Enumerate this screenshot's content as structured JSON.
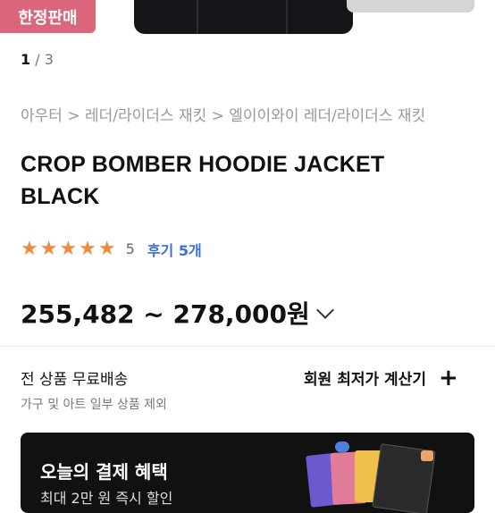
{
  "top": {
    "badge": "한정판매"
  },
  "pager": {
    "current": "1",
    "separator": " / ",
    "total": "3"
  },
  "breadcrumb": {
    "text": "아우터 > 레더/라이더스 재킷 > 엘이이와이 레더/라이더스 재킷"
  },
  "product": {
    "title": "CROP BOMBER HOODIE JACKET BLACK",
    "stars": "★★★★★",
    "rating": "5",
    "review_link": "후기 5개",
    "price": "255,482 ~ 278,000원"
  },
  "shipping": {
    "main": "전 상품 무료배송",
    "sub": "가구 및 아트 일부 상품 제외",
    "calc_label": "회원 최저가 계산기",
    "calc_icon": "+"
  },
  "banner": {
    "title": "오늘의 결제 혜택",
    "subtitle": "최대 2만 원 즉시 할인"
  },
  "colors": {
    "badge": "#d9667a",
    "star": "#f08a3e",
    "link": "#3a6fd8"
  }
}
